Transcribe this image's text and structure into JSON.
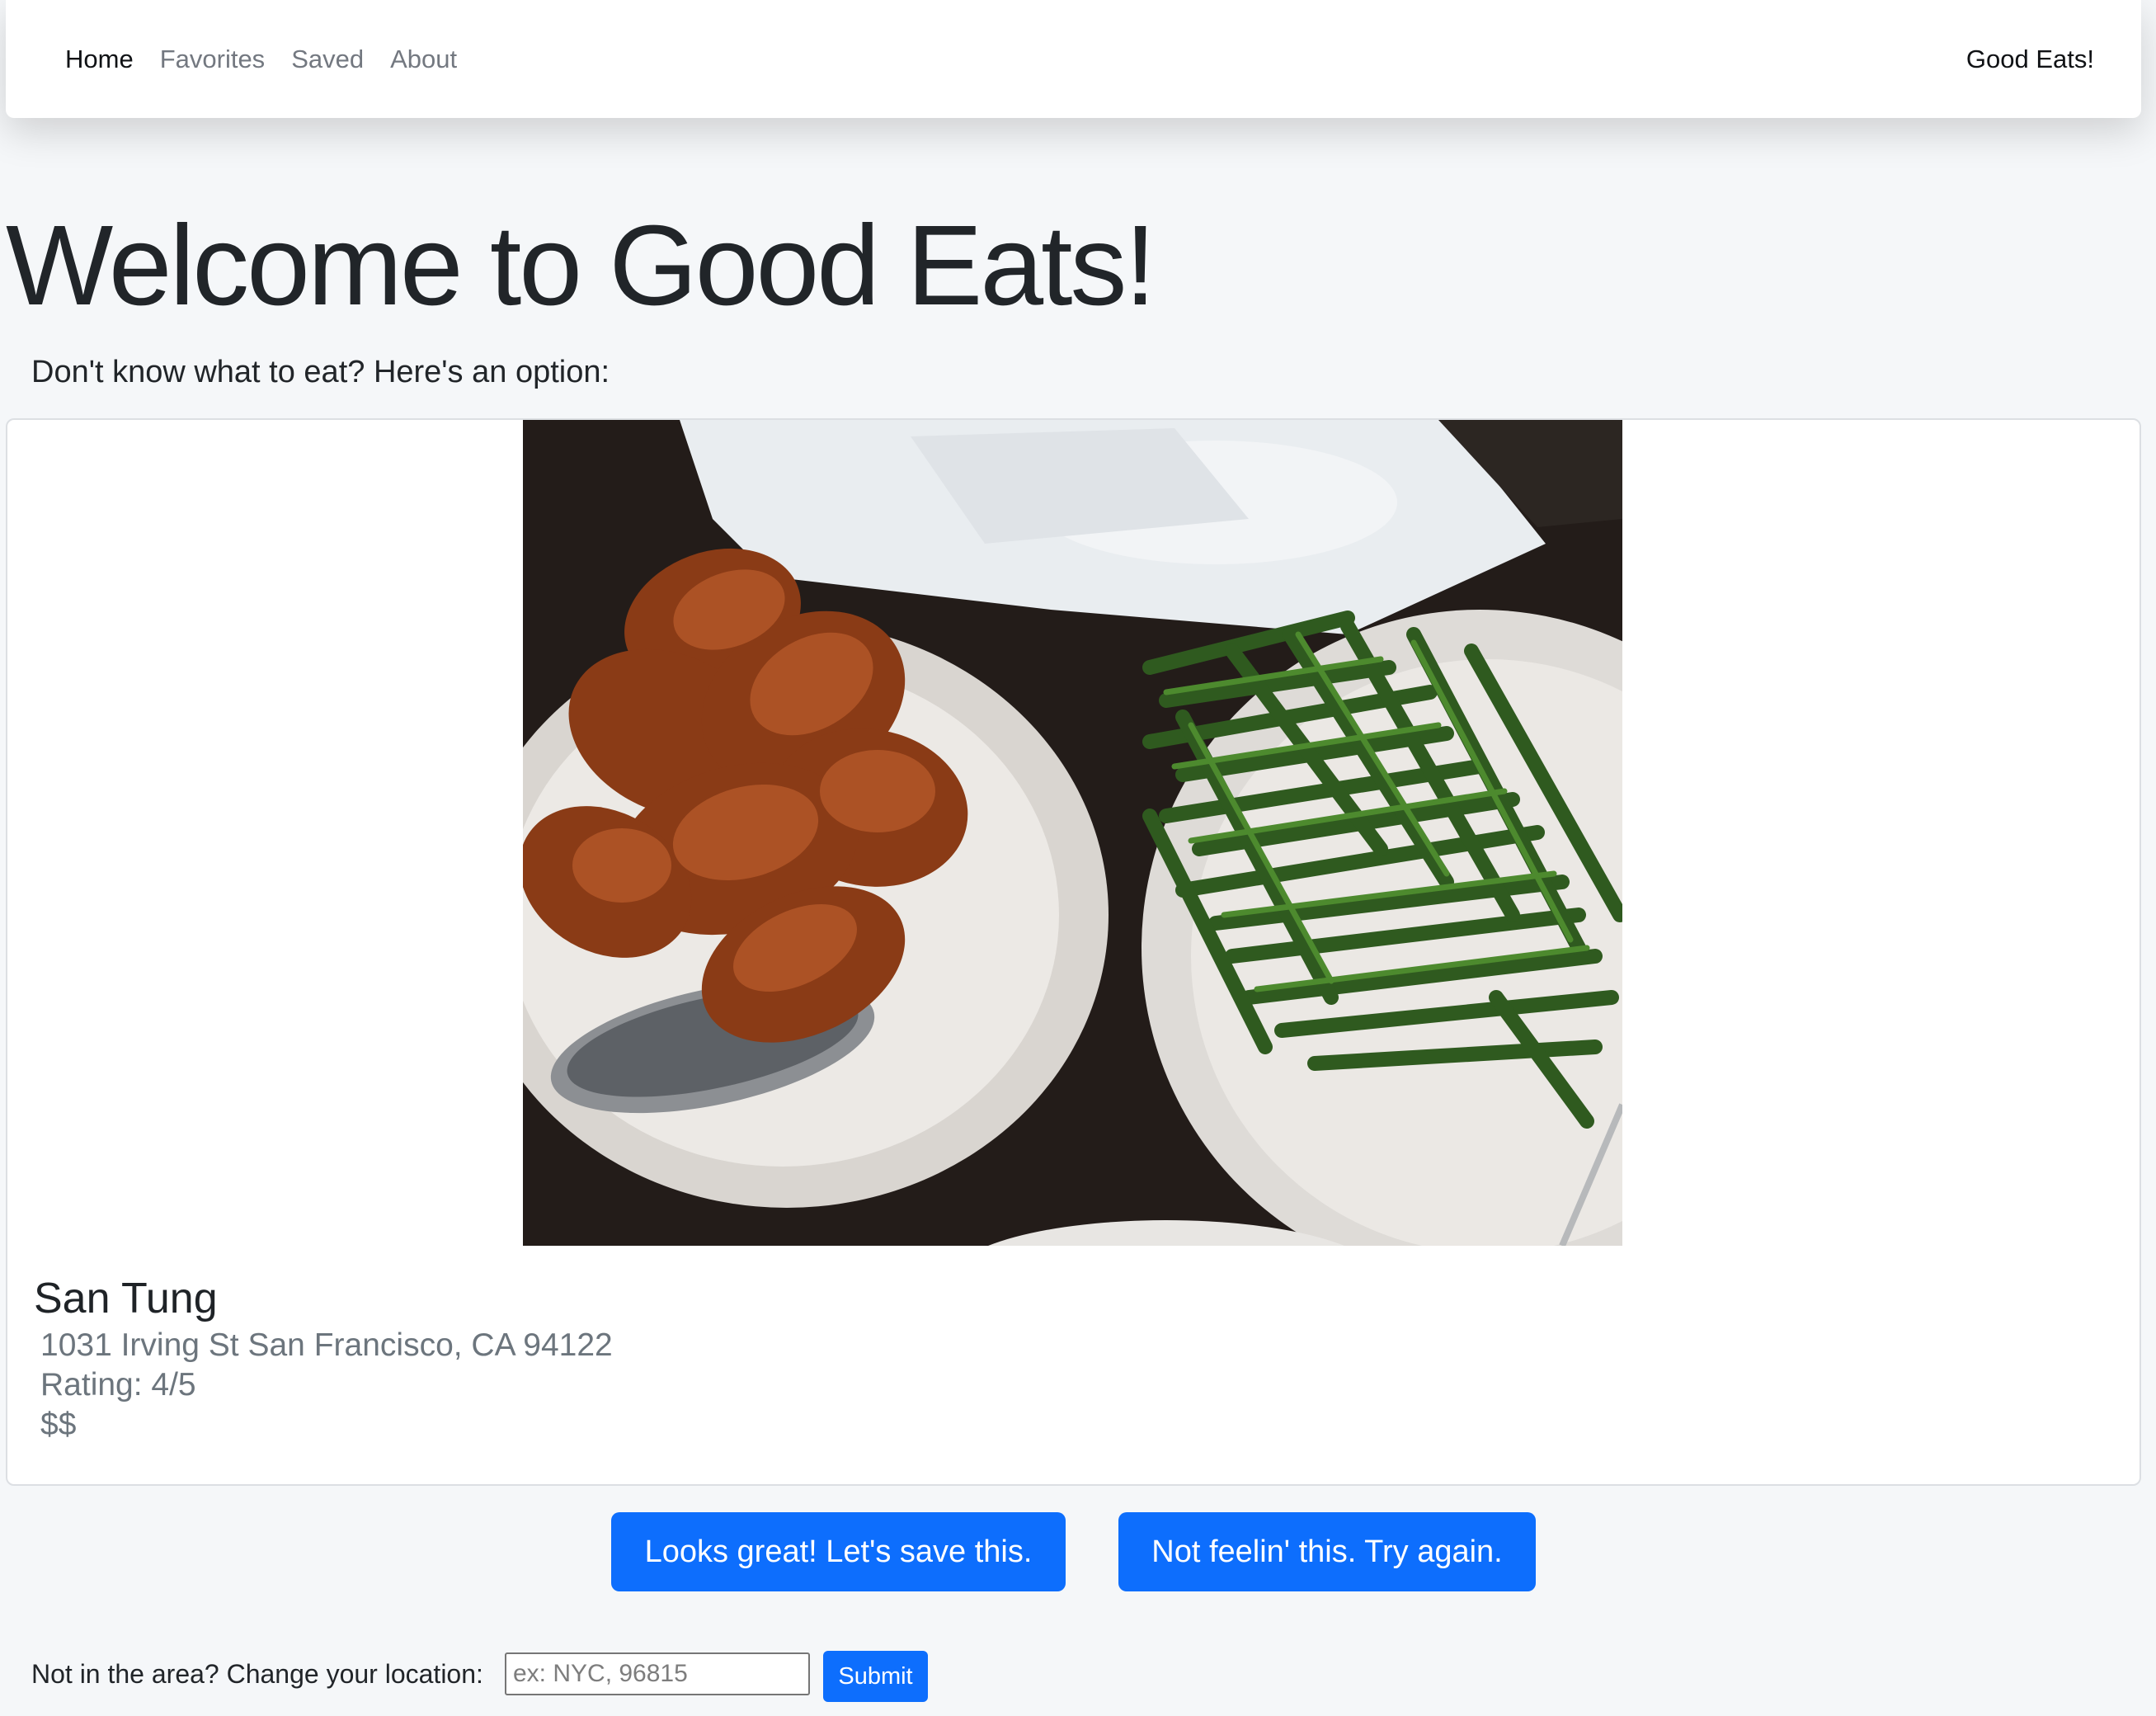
{
  "navbar": {
    "links": [
      {
        "label": "Home",
        "active": true
      },
      {
        "label": "Favorites",
        "active": false
      },
      {
        "label": "Saved",
        "active": false
      },
      {
        "label": "About",
        "active": false
      }
    ],
    "brand": "Good Eats!"
  },
  "page": {
    "title": "Welcome to Good Eats!",
    "subtitle": "Don't know what to eat? Here's an option:"
  },
  "restaurant": {
    "image_icon": "food-photo",
    "name": "San Tung",
    "address": "1031 Irving St San Francisco, CA 94122",
    "rating": "Rating: 4/5",
    "price": "$$"
  },
  "actions": {
    "save_label": "Looks great! Let's save this.",
    "retry_label": "Not feelin' this. Try again."
  },
  "location": {
    "label": "Not in the area? Change your location:",
    "placeholder": "ex: NYC, 96815",
    "value": "",
    "submit_label": "Submit"
  },
  "colors": {
    "accent": "#0d6efd",
    "background": "#f5f7f9",
    "muted_text": "#6c757d"
  }
}
